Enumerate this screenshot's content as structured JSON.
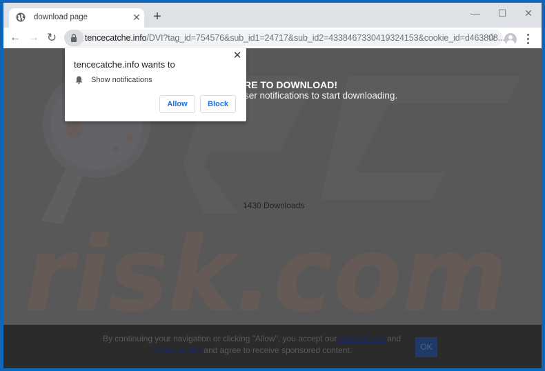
{
  "browser": {
    "tab": {
      "title": "download page",
      "favicon": "globe-icon",
      "close_glyph": "✕"
    },
    "new_tab_glyph": "+",
    "window_controls": {
      "minimize": "—",
      "maximize": "☐",
      "close": "✕"
    },
    "nav": {
      "back": "←",
      "forward": "→",
      "reload": "↻"
    },
    "address": {
      "host": "tencecatche.info",
      "path": "/DVI?tag_id=754576&sub_id1=24717&sub_id2=4338467330419324153&cookie_id=d463808...",
      "secure_icon": "lock-icon"
    },
    "bookmark_glyph": "☆"
  },
  "page": {
    "headline": "RE TO DOWNLOAD!",
    "subline": "ser notifications to start downloading.",
    "downloads_count": "1430 Downloads",
    "watermark": {
      "text_top": "PC",
      "text_bottom": "risk.com"
    }
  },
  "consent": {
    "text_before": "By continuing your navigation or clicking \"Allow\", you accept our ",
    "terms_link": "terms of use ",
    "text_mid": "and",
    "privacy_link": "privacy policy ",
    "text_after": "and agree to receive sponsored content.",
    "ok_label": "OK"
  },
  "permission_popup": {
    "title": "tencecatche.info wants to",
    "permission": "Show notifications",
    "permission_icon": "bell-icon",
    "allow_label": "Allow",
    "block_label": "Block",
    "close_glyph": "✕"
  },
  "colors": {
    "window_frame": "#0f66b8",
    "page_overlay": "#585858",
    "consent_bg": "#2b2b2b",
    "link": "#17246b",
    "button_text": "#1a73e8",
    "ok_bg": "#1e3a66"
  }
}
